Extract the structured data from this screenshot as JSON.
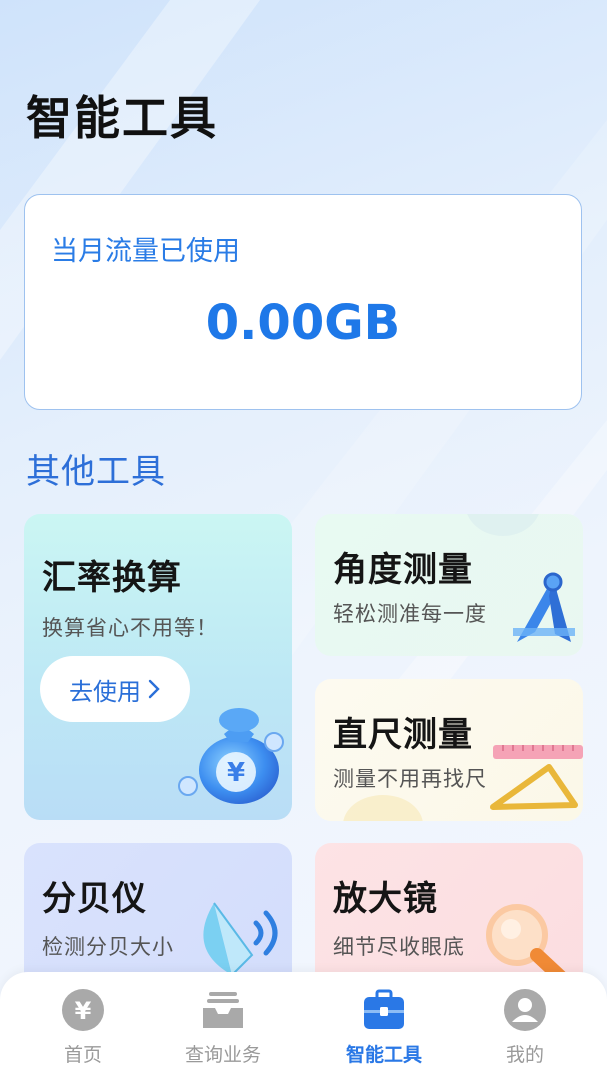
{
  "page": {
    "title": "智能工具"
  },
  "usage": {
    "label": "当月流量已使用",
    "value": "0.00GB"
  },
  "section": {
    "title": "其他工具"
  },
  "tools": {
    "rate": {
      "title": "汇率换算",
      "desc": "换算省心不用等！",
      "button": "去使用"
    },
    "angle": {
      "title": "角度测量",
      "desc": "轻松测准每一度"
    },
    "ruler": {
      "title": "直尺测量",
      "desc": "测量不用再找尺"
    },
    "decibel": {
      "title": "分贝仪",
      "desc": "检测分贝大小"
    },
    "magnifier": {
      "title": "放大镜",
      "desc": "细节尽收眼底"
    }
  },
  "tabbar": {
    "items": [
      {
        "label": "首页",
        "icon": "yen-icon"
      },
      {
        "label": "查询业务",
        "icon": "tray-icon"
      },
      {
        "label": "智能工具",
        "icon": "briefcase-icon",
        "active": true
      },
      {
        "label": "我的",
        "icon": "user-icon"
      }
    ]
  },
  "colors": {
    "accent": "#2a78e6",
    "inactive": "#9a9a9a"
  }
}
